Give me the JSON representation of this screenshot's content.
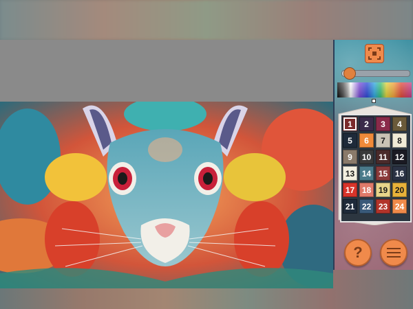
{
  "app": {
    "screen": "paint-by-number"
  },
  "colors": {
    "accent": "#f08a4b",
    "panel_border": "#e6e6e6"
  },
  "controls": {
    "focus_icon": "focus-frame-icon",
    "zoom_level_fraction": 0.1,
    "help_icon": "question-icon",
    "help_label": "?",
    "menu_icon": "hamburger-icon"
  },
  "palette": {
    "selected": 1,
    "colors": [
      {
        "number": "1",
        "color": "#7a2a2a"
      },
      {
        "number": "2",
        "color": "#3a2a4a"
      },
      {
        "number": "3",
        "color": "#8a2a4a"
      },
      {
        "number": "4",
        "color": "#6a5a3a"
      },
      {
        "number": "5",
        "color": "#1e2a3a"
      },
      {
        "number": "6",
        "color": "#f08a3a"
      },
      {
        "number": "7",
        "color": "#c9c2b4"
      },
      {
        "number": "8",
        "color": "#f1ebd6"
      },
      {
        "number": "9",
        "color": "#8a7a6a"
      },
      {
        "number": "10",
        "color": "#3a3a3a"
      },
      {
        "number": "11",
        "color": "#4a2a2a"
      },
      {
        "number": "12",
        "color": "#1a1a22"
      },
      {
        "number": "13",
        "color": "#f3efe0"
      },
      {
        "number": "14",
        "color": "#4a7a8a"
      },
      {
        "number": "15",
        "color": "#8a3a3a"
      },
      {
        "number": "16",
        "color": "#2a3244"
      },
      {
        "number": "17",
        "color": "#d8342a"
      },
      {
        "number": "18",
        "color": "#e07a6a"
      },
      {
        "number": "19",
        "color": "#e8d48a"
      },
      {
        "number": "20",
        "color": "#e8b23a"
      },
      {
        "number": "21",
        "color": "#1e2a3a"
      },
      {
        "number": "22",
        "color": "#3a5a7a"
      },
      {
        "number": "23",
        "color": "#b2342a"
      },
      {
        "number": "24",
        "color": "#f08a4a"
      }
    ]
  }
}
